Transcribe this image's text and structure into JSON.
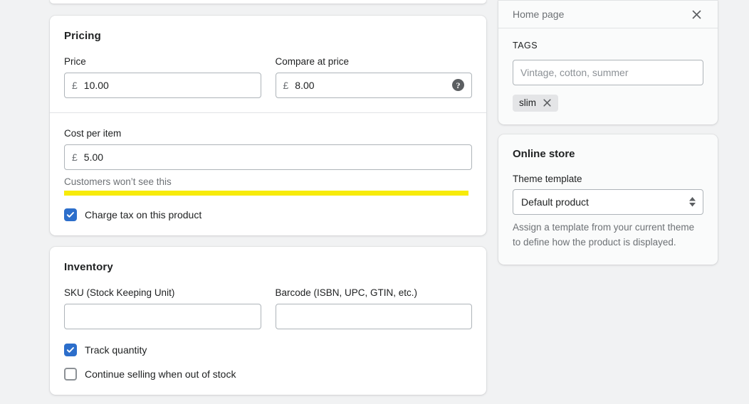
{
  "theme": {
    "page_background": "#f1f2f3",
    "card_background": "#ffffff",
    "panel_background": "#fafbfb",
    "accent": "#2c6ecb",
    "highlight": "#f7eb0a",
    "border": "#aeb4b9",
    "text": "#202223",
    "subdued_text": "#6d7175"
  },
  "pricing": {
    "title": "Pricing",
    "price": {
      "label": "Price",
      "currency": "£",
      "value": "10.00"
    },
    "compare_at_price": {
      "label": "Compare at price",
      "currency": "£",
      "value": "8.00",
      "help_icon": "question-mark-circle-icon"
    },
    "cost_per_item": {
      "label": "Cost per item",
      "currency": "£",
      "value": "5.00",
      "help_text": "Customers won’t see this"
    },
    "charge_tax": {
      "label": "Charge tax on this product",
      "checked": true
    }
  },
  "inventory": {
    "title": "Inventory",
    "sku": {
      "label": "SKU (Stock Keeping Unit)",
      "value": ""
    },
    "barcode": {
      "label": "Barcode (ISBN, UPC, GTIN, etc.)",
      "value": ""
    },
    "track_quantity": {
      "label": "Track quantity",
      "checked": true
    },
    "continue_selling": {
      "label": "Continue selling when out of stock",
      "checked": false
    }
  },
  "tags_panel": {
    "home_page": {
      "label": "Home page",
      "close_icon": "close-icon"
    },
    "heading": "TAGS",
    "input_placeholder": "Vintage, cotton, summer",
    "input_value": "",
    "chips": [
      {
        "label": "slim",
        "remove_icon": "close-icon"
      }
    ]
  },
  "online_store": {
    "title": "Online store",
    "theme_template": {
      "label": "Theme template",
      "selected": "Default product",
      "options": [
        "Default product"
      ],
      "arrows_icon": "select-stepper-icon"
    },
    "help_text": "Assign a template from your current theme to define how the product is displayed."
  }
}
